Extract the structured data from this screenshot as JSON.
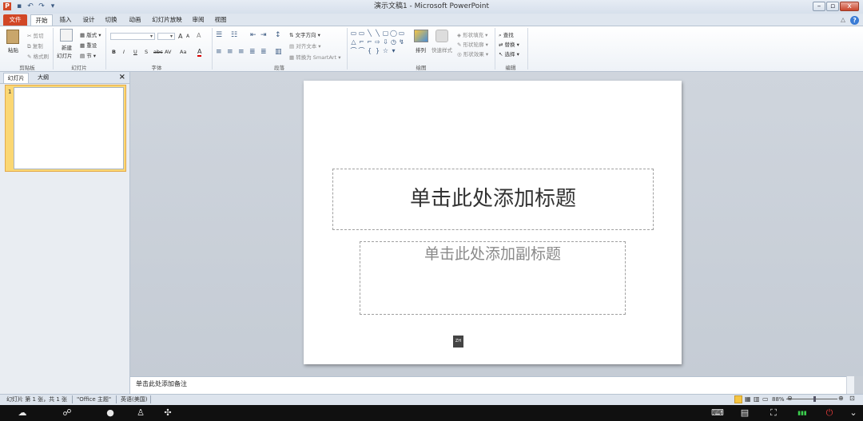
{
  "app": {
    "icon_label": "P",
    "window_title": "演示文稿1 - Microsoft PowerPoint",
    "qat": [
      "save-icon",
      "undo-icon",
      "redo-icon",
      "customize-icon"
    ],
    "qat_glyphs": [
      "▪",
      "↶",
      "↷",
      "▾"
    ]
  },
  "window_controls": {
    "minimize": "–",
    "restore": "▫",
    "close": "x"
  },
  "tabs": [
    {
      "label": "文件"
    },
    {
      "label": "开始"
    },
    {
      "label": "插入"
    },
    {
      "label": "设计"
    },
    {
      "label": "切换"
    },
    {
      "label": "动画"
    },
    {
      "label": "幻灯片放映"
    },
    {
      "label": "审阅"
    },
    {
      "label": "视图"
    }
  ],
  "tab_extras": {
    "collapse": "△",
    "help": "?"
  },
  "ribbon": {
    "clipboard": {
      "paste": "粘贴",
      "cut": "剪切",
      "copy": "复制",
      "format_painter": "格式刷",
      "group": "剪贴板"
    },
    "slides": {
      "new_slide_1": "新建",
      "new_slide_2": "幻灯片",
      "layout": "版式",
      "reset": "重设",
      "section": "节",
      "group": "幻灯片"
    },
    "font": {
      "bold": "B",
      "italic": "I",
      "underline": "U",
      "strike": "S",
      "abc": "abc",
      "spacing": "AV",
      "case": "Aa",
      "color": "A",
      "grow": "A",
      "shrink": "A",
      "clear": "A",
      "group": "字体"
    },
    "paragraph": {
      "text_direction": "文字方向",
      "align_text": "对齐文本",
      "convert_smartart": "转换为 SmartArt",
      "group": "段落"
    },
    "drawing": {
      "arrange": "排列",
      "quick_styles": "快速样式",
      "shape_fill": "形状填充",
      "shape_outline": "形状轮廓",
      "shape_effects": "形状效果",
      "group": "绘图",
      "shapes": [
        "▭",
        "▭",
        "╲",
        "╲",
        "▢",
        "◯",
        "▭",
        "△",
        "⌐",
        "⌐",
        "⇨",
        "⇩",
        "◷",
        "↯",
        "⌒",
        "⌒",
        "{",
        "}",
        "☆",
        "▾"
      ]
    },
    "editing": {
      "find": "查找",
      "replace": "替换",
      "select": "选择",
      "group": "编辑"
    }
  },
  "left_panel": {
    "tab_slides": "幻灯片",
    "tab_outline": "大纲",
    "close": "×",
    "slide_number": "1"
  },
  "slide": {
    "title_placeholder": "单击此处添加标题",
    "subtitle_placeholder": "单击此处添加副标题",
    "ime_badge": "ZH"
  },
  "notes": {
    "placeholder": "单击此处添加备注"
  },
  "status": {
    "slide_info": "幻灯片 第 1 张，共 1 张",
    "theme": "\"Office 主题\"",
    "language": "英语(美国)",
    "zoom": "88%",
    "zoom_fraction": 0.55
  },
  "taskbar": {
    "left_icons": [
      "cloud-icon",
      "chat-icon",
      "info-icon",
      "user-icon",
      "settings-icon"
    ],
    "left_glyphs": [
      "☁",
      "☍",
      "●",
      "♙",
      "✣"
    ],
    "right_icons": [
      "keyboard-icon",
      "keyboard-alt-icon",
      "fullscreen-icon",
      "signal-icon",
      "power-icon",
      "chevron-down-icon"
    ],
    "right_glyphs": [
      "⌨",
      "▤",
      "⛶",
      "▮▮▮",
      "⏻",
      "⌄"
    ]
  }
}
